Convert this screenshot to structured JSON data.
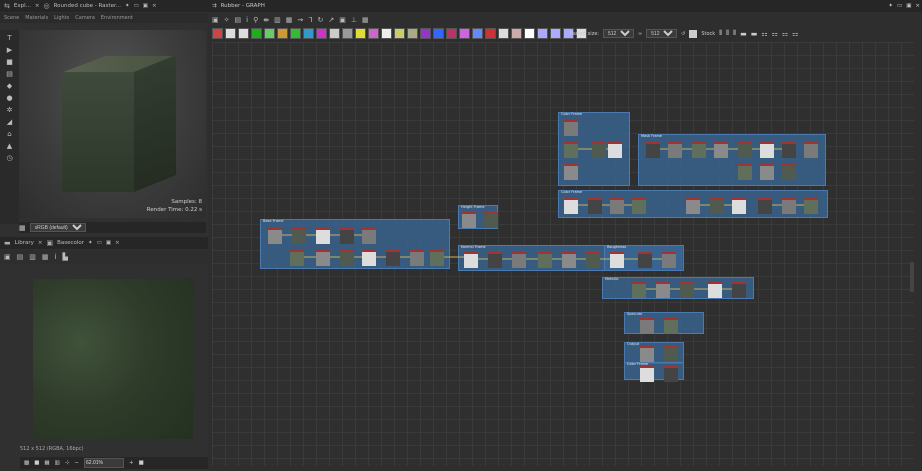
{
  "left_tabs": {
    "explorer": "Expl...",
    "viewer": "Rounded cube - Raster..."
  },
  "scene_menu": [
    "Scene",
    "Materials",
    "Lights",
    "Camera",
    "Environment"
  ],
  "viewport": {
    "samples": "Samples: 8",
    "render_time": "Render Time: 0.22 s"
  },
  "color_space": "sRGB (default)",
  "library_tabs": {
    "library": "Library",
    "basecolor": "Basecolor"
  },
  "texture_info": "512 x 512 (RGBA, 16bpc)",
  "zoom": "62.01%",
  "graph_tab": "Rubber - GRAPH",
  "parent_size_label": "Parent size:",
  "parent_size_w": "512",
  "parent_size_h": "512",
  "stock_label": "Stock",
  "frames": [
    {
      "title": "Color Frame"
    },
    {
      "title": "Mask Frame"
    },
    {
      "title": "Color Frame"
    },
    {
      "title": "Base Frame"
    },
    {
      "title": "Height Frame"
    },
    {
      "title": "Normal Frame"
    },
    {
      "title": "Roughness"
    },
    {
      "title": "Metallic"
    },
    {
      "title": "Specular"
    },
    {
      "title": "Output"
    }
  ],
  "colors": {
    "frame": "#3a6696",
    "node_header": "#a33333",
    "bg": "#2b2b2b"
  }
}
